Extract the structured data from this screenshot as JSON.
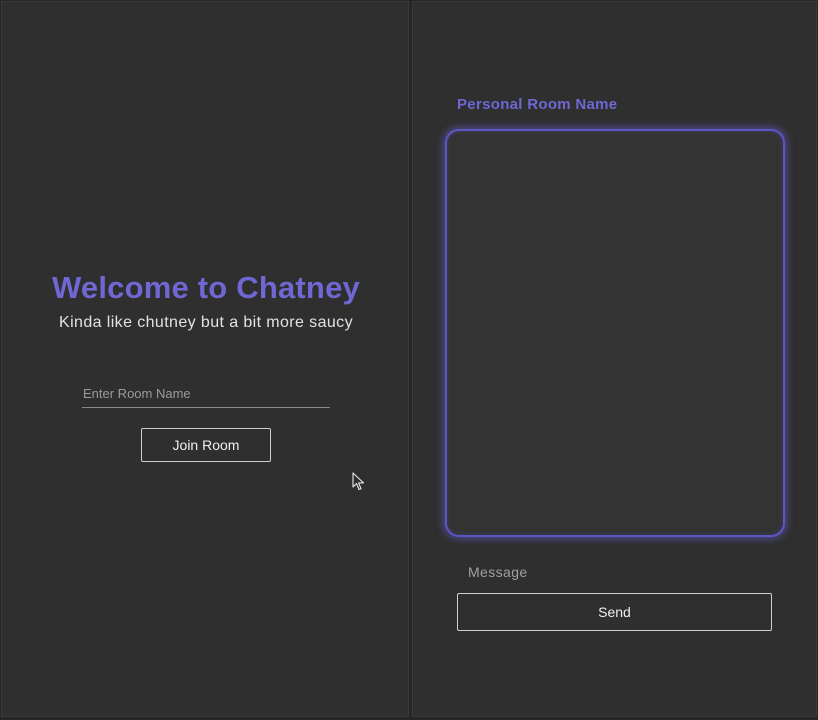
{
  "welcome": {
    "title": "Welcome to Chatney",
    "subtitle": "Kinda like chutney but a bit more saucy"
  },
  "join": {
    "room_input_placeholder": "Enter Room Name",
    "room_input_value": "",
    "join_label": "Join Room"
  },
  "room": {
    "name_label": "Personal Room Name",
    "messages": [],
    "message_placeholder": "Message",
    "message_value": "",
    "send_label": "Send"
  },
  "colors": {
    "accent": "#6f68d4",
    "panel_background": "#2f2f2f",
    "text": "#e3e3e3"
  },
  "icons": {
    "pointer": "mouse-pointer-icon"
  }
}
